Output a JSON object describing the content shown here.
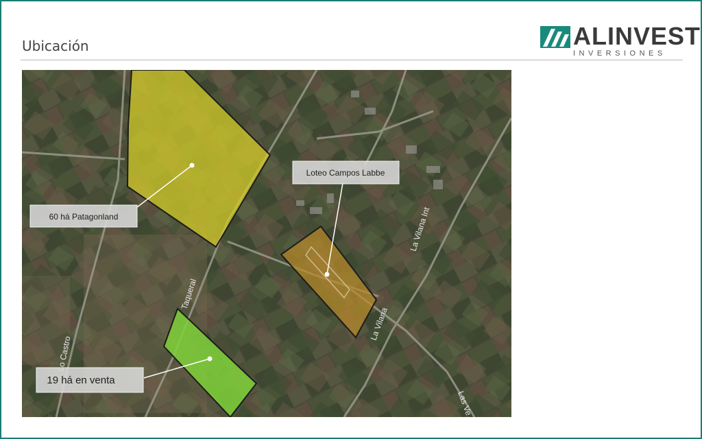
{
  "slide": {
    "title": "Ubicación"
  },
  "logo": {
    "name": "ALINVEST",
    "subtitle": "INVERSIONES",
    "colors": {
      "mark": "#1a8a7d",
      "text": "#3a3a3a"
    }
  },
  "map": {
    "parcels": [
      {
        "label": "60 há Patagonland",
        "fill": "#d4cc2a",
        "stroke": "#1c1c1c"
      },
      {
        "label": "Loteo Campos Labbe",
        "fill": "#b88a2a",
        "stroke": "#1c1c1c"
      },
      {
        "label": "19 há en venta",
        "fill": "#7fd13a",
        "stroke": "#1c1c1c"
      }
    ],
    "roads": [
      "Lo Castro",
      "Taqueral",
      "La Vilana Int",
      "La Vilana",
      "Las Ve"
    ]
  }
}
